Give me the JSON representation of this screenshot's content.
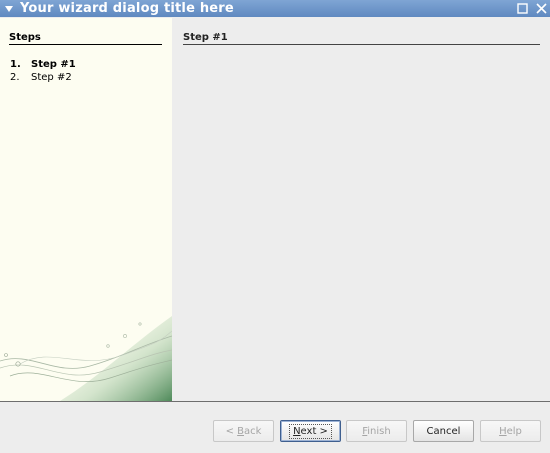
{
  "window": {
    "title": "Your wizard dialog title here"
  },
  "steps_panel": {
    "header": "Steps",
    "items": [
      {
        "number": "1.",
        "label": "Step #1",
        "current": true
      },
      {
        "number": "2.",
        "label": "Step #2",
        "current": false
      }
    ]
  },
  "content": {
    "header": "Step #1"
  },
  "buttons": {
    "back": {
      "prefix": "< ",
      "mnemonic": "B",
      "rest": "ack",
      "enabled": false
    },
    "next": {
      "prefix": "",
      "mnemonic": "N",
      "rest": "ext >",
      "enabled": true
    },
    "finish": {
      "prefix": "",
      "mnemonic": "F",
      "rest": "inish",
      "enabled": false
    },
    "cancel": {
      "label": "Cancel",
      "enabled": true
    },
    "help": {
      "prefix": "",
      "mnemonic": "H",
      "rest": "elp",
      "enabled": false
    }
  },
  "colors": {
    "titlebar": "#6b93c8",
    "steps_background": "#fdfdf1",
    "content_background": "#ededed"
  },
  "icons": {
    "window_menu": "triangle-down-icon",
    "maximize": "maximize-icon",
    "close": "close-icon"
  }
}
